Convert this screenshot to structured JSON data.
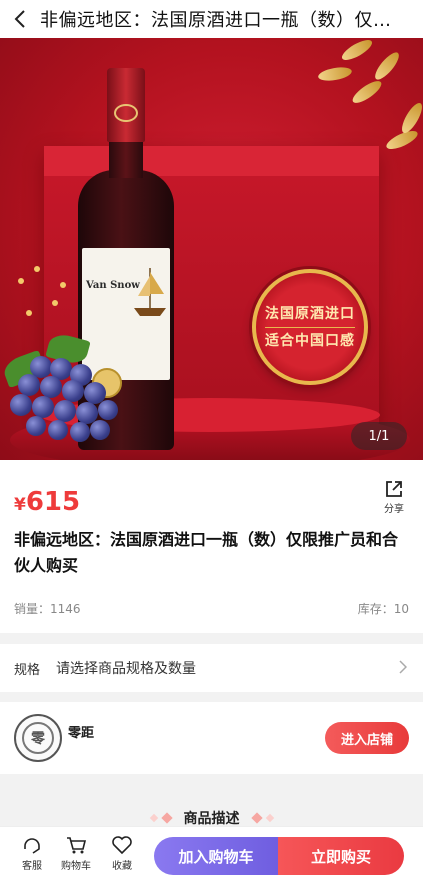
{
  "header": {
    "title": "非偏远地区：法国原酒进口一瓶（数）仅限推广员和合伙人购买",
    "back_icon": "chevron-left-icon"
  },
  "gallery": {
    "pager": "1/1",
    "bottle_brand": "Van Snow",
    "badge_line1": "法国原酒进口",
    "badge_line2": "适合中国口感"
  },
  "product": {
    "currency": "¥",
    "price": "615",
    "share_label": "分享",
    "title": "非偏远地区：法国原酒进口一瓶（数）仅限推广员和合伙人购买",
    "sales": "销量：1146",
    "stock": "库存：10"
  },
  "spec": {
    "label": "规格",
    "placeholder": "请选择商品规格及数量"
  },
  "shop": {
    "name": "零距",
    "enter_label": "进入店铺"
  },
  "description": {
    "title": "商品描述"
  },
  "bottom_bar": {
    "service_label": "客服",
    "cart_label": "购物车",
    "favorite_label": "收藏",
    "add_to_cart": "加入购物车",
    "buy_now": "立即购买"
  },
  "colors": {
    "price": "#ee3b3b",
    "cart_button": "#7b6ae8",
    "buy_button": "#f04a4d",
    "hero_bg": "#c3172a"
  }
}
